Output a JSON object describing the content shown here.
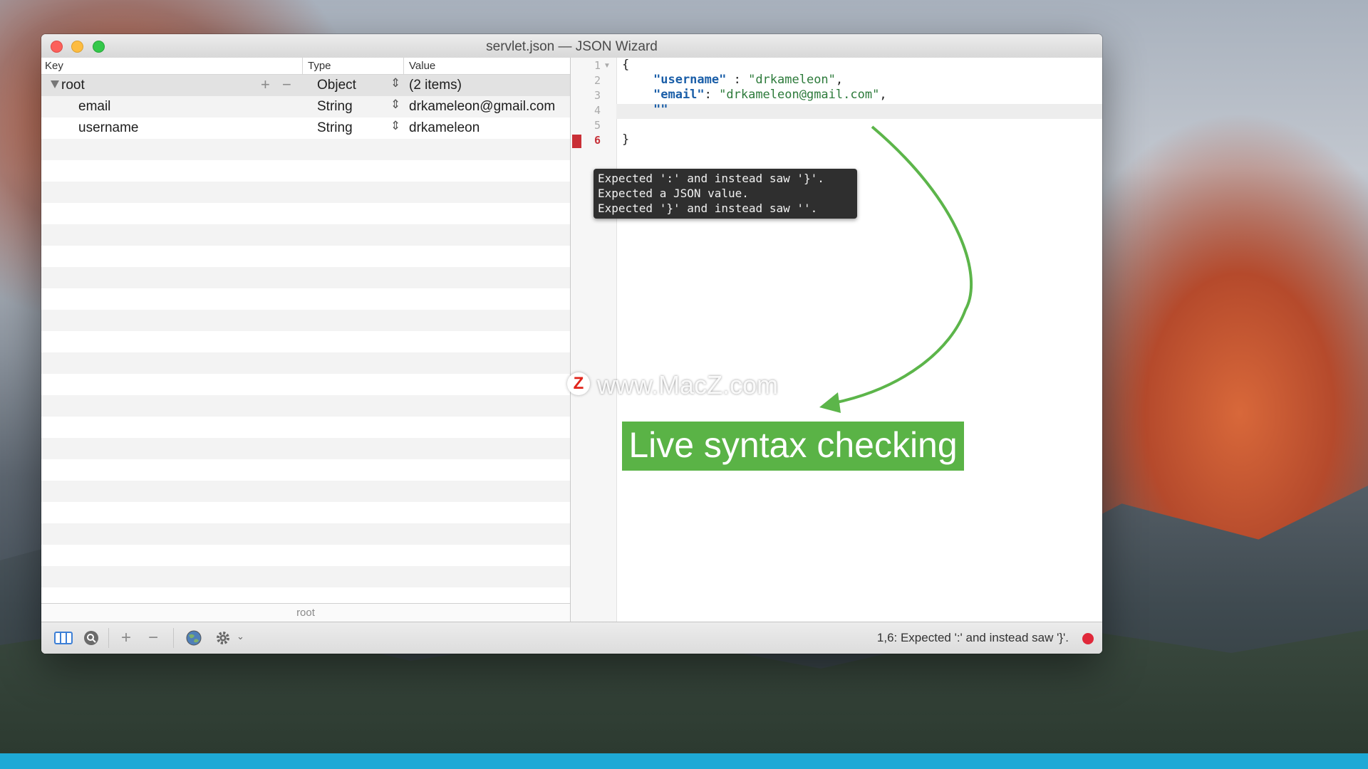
{
  "window": {
    "title": "servlet.json — JSON Wizard"
  },
  "outline": {
    "columns": {
      "key": "Key",
      "type": "Type",
      "value": "Value"
    },
    "rows": [
      {
        "key": "root",
        "type": "Object",
        "value": "(2 items)",
        "expanded": true,
        "selected": true
      },
      {
        "key": "email",
        "type": "String",
        "value": "drkameleon@gmail.com"
      },
      {
        "key": "username",
        "type": "String",
        "value": "drkameleon"
      }
    ],
    "path": "root"
  },
  "editor": {
    "line_numbers": [
      "1",
      "2",
      "3",
      "4",
      "5",
      "6"
    ],
    "error_line": "6",
    "lines": {
      "l1_brace": "{",
      "l2_key": "\"username\"",
      "l2_sep": " : ",
      "l2_value": "\"drkameleon\"",
      "l2_end": ",",
      "l3_key": "\"email\"",
      "l3_sep": ": ",
      "l3_value": "\"drkameleon@gmail.com\"",
      "l3_end": ",",
      "l4_text": "\"\"",
      "l6_brace": "}"
    },
    "tooltip": [
      "Expected ':' and instead saw '}'.",
      "Expected a JSON value.",
      "Expected '}' and instead saw ''."
    ]
  },
  "toolbar": {
    "add": "+",
    "remove": "−",
    "status": "1,6: Expected ':' and instead saw '}'.",
    "status_color": "#e0283a"
  },
  "annotation": {
    "label": "Live syntax checking",
    "color": "#5ab346"
  },
  "watermark": {
    "logo": "Z",
    "text": "www.MacZ.com"
  }
}
